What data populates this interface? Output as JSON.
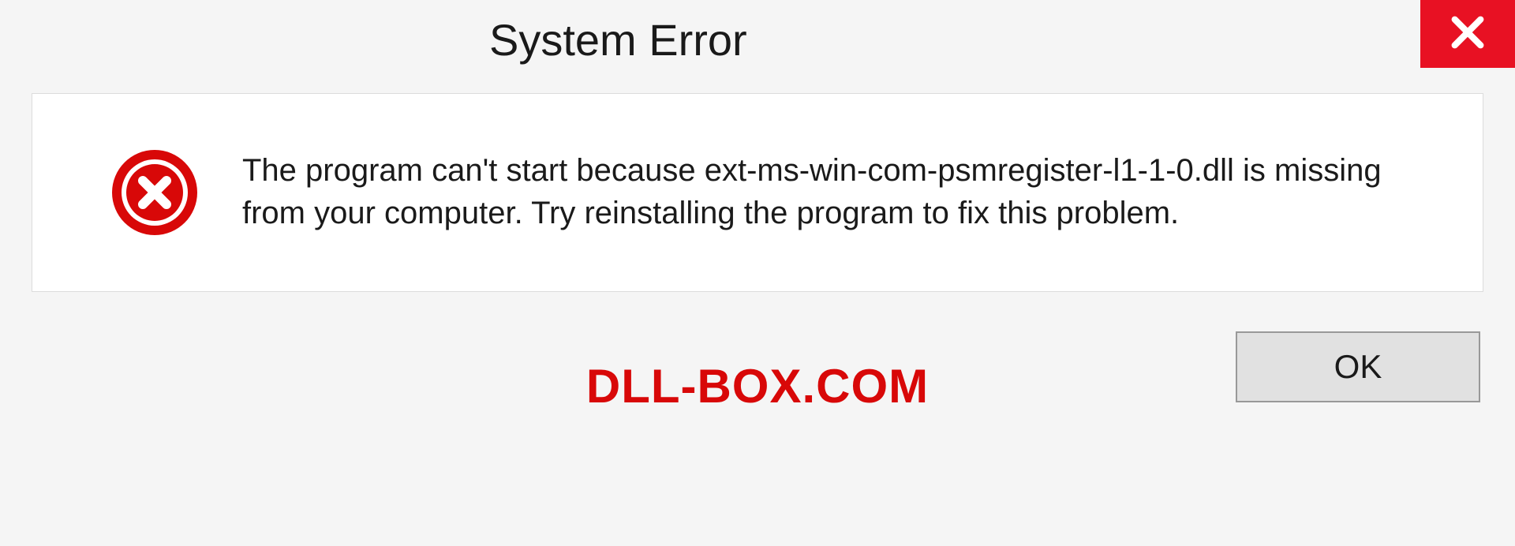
{
  "titlebar": {
    "title": "System Error"
  },
  "content": {
    "message": "The program can't start because ext-ms-win-com-psmregister-l1-1-0.dll is missing from your computer. Try reinstalling the program to fix this problem."
  },
  "footer": {
    "watermark": "DLL-BOX.COM",
    "ok_label": "OK"
  },
  "colors": {
    "close_button_bg": "#e81123",
    "error_icon": "#d80808",
    "watermark": "#d80808"
  }
}
